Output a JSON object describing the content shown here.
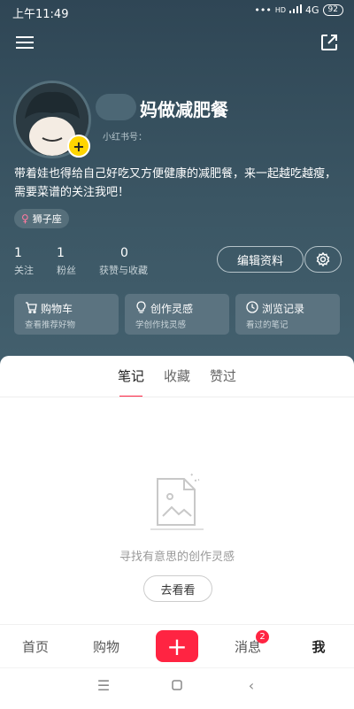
{
  "status": {
    "time": "上午11:49",
    "signal": "HD",
    "network": "4G",
    "battery": "92"
  },
  "profile": {
    "nickname": "妈做减肥餐",
    "id_label": "小红书号：",
    "bio": "带着娃也得给自己好吃又方便健康的减肥餐，来一起越吃越瘦，需要菜谱的关注我吧！",
    "tag": "狮子座",
    "stats": [
      {
        "value": "1",
        "label": "关注"
      },
      {
        "value": "1",
        "label": "粉丝"
      },
      {
        "value": "0",
        "label": "获赞与收藏"
      }
    ],
    "edit_label": "编辑资料"
  },
  "cards": [
    {
      "title": "购物车",
      "sub": "查看推荐好物",
      "icon": "cart-icon"
    },
    {
      "title": "创作灵感",
      "sub": "学创作找灵感",
      "icon": "lightbulb-icon"
    },
    {
      "title": "浏览记录",
      "sub": "看过的笔记",
      "icon": "clock-icon"
    }
  ],
  "tabs": [
    {
      "label": "笔记",
      "active": true
    },
    {
      "label": "收藏",
      "active": false
    },
    {
      "label": "赞过",
      "active": false
    }
  ],
  "empty": {
    "text": "寻找有意思的创作灵感",
    "button": "去看看"
  },
  "bottom_nav": {
    "home": "首页",
    "shop": "购物",
    "plus": "+",
    "messages": "消息",
    "messages_badge": "2",
    "me": "我"
  },
  "colors": {
    "accent": "#ff2442",
    "hero": "#3b5664"
  }
}
